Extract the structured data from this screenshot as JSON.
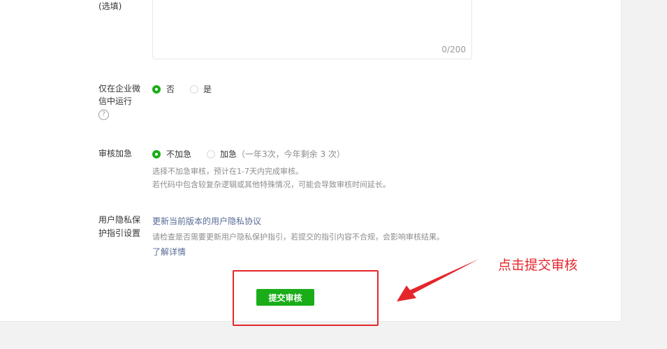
{
  "description_field": {
    "label_suffix": "(选填)",
    "counter": "0/200"
  },
  "enterprise_wechat": {
    "label_line1": "仅在企业微",
    "label_line2": "信中运行",
    "help_icon_glyph": "?",
    "options": [
      {
        "label": "否",
        "selected": true
      },
      {
        "label": "是",
        "selected": false
      }
    ]
  },
  "review_urgency": {
    "label": "审核加急",
    "options": [
      {
        "label": "不加急",
        "selected": true
      },
      {
        "label": "加急",
        "detail": "（一年3次，今年剩余  3  次）",
        "selected": false
      }
    ],
    "hint_line1": "选择不加急审核，预计在1-7天内完成审核。",
    "hint_line2": "若代码中包含较复杂逻辑或其他特殊情况，可能会导致审核时间延长。"
  },
  "privacy": {
    "label_line1": "用户隐私保",
    "label_line2": "护指引设置",
    "update_link": "更新当前版本的用户隐私协议",
    "hint": "请检查是否需要更新用户隐私保护指引，若提交的指引内容不合规，会影响审核结果。",
    "details_link": "了解详情"
  },
  "submit_button": "提交审核",
  "annotation": {
    "text": "点击提交审核",
    "color": "#e5262b"
  },
  "colors": {
    "primary_green": "#1aad19",
    "link_blue": "#576b95"
  }
}
